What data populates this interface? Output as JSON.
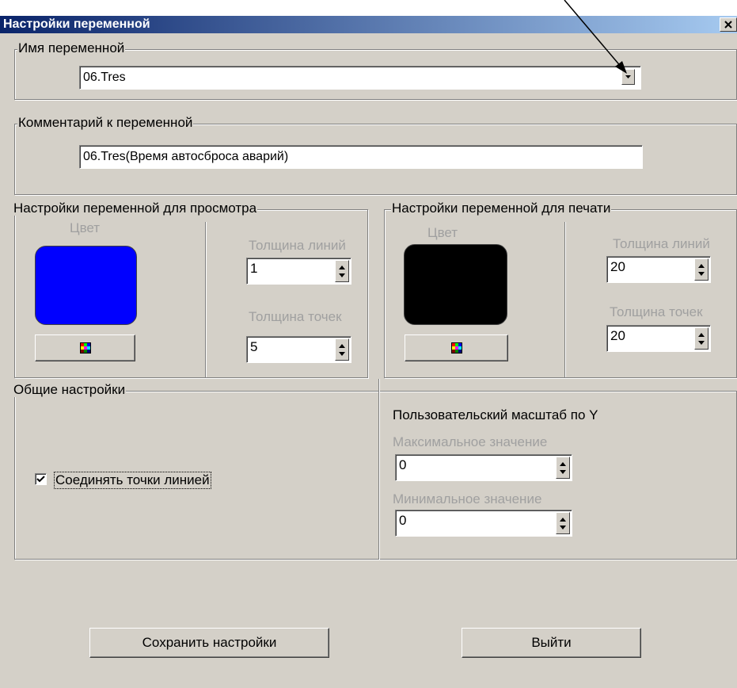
{
  "window": {
    "title": "Настройки переменной"
  },
  "variable_name": {
    "legend": "Имя переменной",
    "value": "06.Tres"
  },
  "comment": {
    "legend": "Комментарий к переменной",
    "value": "06.Tres(Время автосброса аварий)"
  },
  "view_settings": {
    "legend": "Настройки переменной для просмотра",
    "color_label": "Цвет",
    "color": "#0000ff",
    "line_width_label": "Толщина линий",
    "line_width": "1",
    "point_width_label": "Толщина точек",
    "point_width": "5"
  },
  "print_settings": {
    "legend": "Настройки переменной для печати",
    "color_label": "Цвет",
    "color": "#000000",
    "line_width_label": "Толщина линий",
    "line_width": "20",
    "point_width_label": "Толщина точек",
    "point_width": "20"
  },
  "general": {
    "legend": "Общие настройки",
    "connect_label": "Соединять точки линией",
    "connect_checked": true
  },
  "scale": {
    "title": "Пользовательский масштаб по Y",
    "max_label": "Максимальное значение",
    "max_value": "0",
    "min_label": "Минимальное значение",
    "min_value": "0"
  },
  "buttons": {
    "save": "Сохранить настройки",
    "exit": "Выйти"
  },
  "icons": {
    "close": "close-icon",
    "dropdown": "chevron-down-icon",
    "palette": "color-palette-icon",
    "spin": "spin-arrows-icon",
    "check": "checkmark-icon"
  }
}
